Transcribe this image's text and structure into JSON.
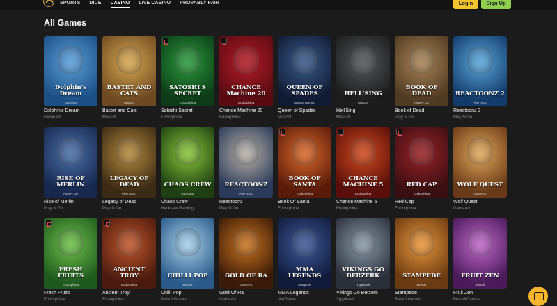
{
  "nav": {
    "items": [
      {
        "label": "SPORTS"
      },
      {
        "label": "DICE"
      },
      {
        "label": "CASINO"
      },
      {
        "label": "LIVE CASINO"
      },
      {
        "label": "PROVABLY FAIR"
      }
    ],
    "active": "CASINO",
    "login_label": "Login",
    "signup_label": "Sign Up"
  },
  "section": {
    "title": "All Games"
  },
  "games": [
    {
      "name": "Dolphin's Dream",
      "provider": "GameArt",
      "thumb_title": "Dolphin's Dream",
      "thumb_provider": "Gameart",
      "badge": false,
      "colors": [
        "#1c4f86",
        "#5b9fd8"
      ]
    },
    {
      "name": "Bastet and Cats",
      "provider": "Mascot",
      "thumb_title": "BASTET AND CATS",
      "thumb_provider": "Mascot",
      "badge": false,
      "colors": [
        "#6e4a22",
        "#d7a84f"
      ]
    },
    {
      "name": "Satoshi Secret",
      "provider": "Endorphina",
      "thumb_title": "SATOSHI'S SECRET",
      "thumb_provider": "Endorphina",
      "badge": true,
      "colors": [
        "#0d3b17",
        "#2a9a3c"
      ]
    },
    {
      "name": "Chance Machine 20",
      "provider": "Endorphina",
      "thumb_title": "CHANCE Machine 20",
      "thumb_provider": "Endorphina",
      "badge": true,
      "colors": [
        "#5a0b12",
        "#b21a26"
      ]
    },
    {
      "name": "Queen of Spades",
      "provider": "Mascot",
      "thumb_title": "QUEEN OF SPADES",
      "thumb_provider": "Mascot gaming",
      "badge": false,
      "colors": [
        "#101a33",
        "#3a5a8a"
      ]
    },
    {
      "name": "Hell'Sing",
      "provider": "Mascot",
      "thumb_title": "HELL'SING",
      "thumb_provider": "Mascot",
      "badge": false,
      "colors": [
        "#1c1c1c",
        "#55575a"
      ]
    },
    {
      "name": "Book of Dead",
      "provider": "Play N Go",
      "thumb_title": "BOOK OF DEAD",
      "thumb_provider": "Play N Go",
      "badge": false,
      "colors": [
        "#4f3a22",
        "#a88456"
      ]
    },
    {
      "name": "Reactoonz 2",
      "provider": "Play N Go",
      "thumb_title": "REACTOONZ 2",
      "thumb_provider": "Play N Go",
      "badge": false,
      "colors": [
        "#123a6a",
        "#59a7da"
      ]
    },
    {
      "name": "Rise of Merlin",
      "provider": "Play N Go",
      "thumb_title": "RISE OF MERLIN",
      "thumb_provider": "Play N Go",
      "badge": false,
      "colors": [
        "#17284e",
        "#4a6fa8"
      ]
    },
    {
      "name": "Legacy of Dead",
      "provider": "Play N Go",
      "thumb_title": "LEGACY OF DEAD",
      "thumb_provider": "Play N Go",
      "badge": false,
      "colors": [
        "#3b2a14",
        "#b58a3c"
      ]
    },
    {
      "name": "Chaos Crew",
      "provider": "Hacksaw Gaming",
      "thumb_title": "CHAOS CREW",
      "thumb_provider": "Hacksaw",
      "badge": false,
      "colors": [
        "#1d3f12",
        "#8ac63a"
      ]
    },
    {
      "name": "Reactoonz",
      "provider": "Play N Go",
      "thumb_title": "REACTOONZ",
      "thumb_provider": "Play N Go",
      "badge": false,
      "colors": [
        "#2a3a5a",
        "#b9b2a6"
      ]
    },
    {
      "name": "Book Of Santa",
      "provider": "Endorphina",
      "thumb_title": "BOOK OF SANTA",
      "thumb_provider": "Endorphina",
      "badge": true,
      "colors": [
        "#5a1a0a",
        "#d9692a"
      ]
    },
    {
      "name": "Chance Machine 5",
      "provider": "Endorphina",
      "thumb_title": "CHANCE MACHINE 5",
      "thumb_provider": "Endorphina",
      "badge": true,
      "colors": [
        "#5a0f0a",
        "#cf4a1e"
      ]
    },
    {
      "name": "Red Cap",
      "provider": "Endorphina",
      "thumb_title": "RED CAP",
      "thumb_provider": "Endorphina",
      "badge": true,
      "colors": [
        "#3b0f12",
        "#9a2227"
      ]
    },
    {
      "name": "Wolf Quest",
      "provider": "GameArt",
      "thumb_title": "WOLF QUEST",
      "thumb_provider": "GameArt",
      "badge": false,
      "colors": [
        "#6a3a18",
        "#e0a85a"
      ]
    },
    {
      "name": "Fresh Fruits",
      "provider": "Endorphina",
      "thumb_title": "FRESH FRUITS",
      "thumb_provider": "Endorphina",
      "badge": true,
      "colors": [
        "#1e5a1e",
        "#6fbf4a"
      ]
    },
    {
      "name": "Ancient Troy",
      "provider": "Endorphina",
      "thumb_title": "ANCIENT TROY",
      "thumb_provider": "Endorphina",
      "badge": true,
      "colors": [
        "#4a1a0e",
        "#c0562a"
      ]
    },
    {
      "name": "Chilli Pop",
      "provider": "BetsoftGames",
      "thumb_title": "CHILLI POP",
      "thumb_provider": "Betsoft",
      "badge": false,
      "colors": [
        "#2a5a8a",
        "#a8d0e8"
      ]
    },
    {
      "name": "Gold Of Ra",
      "provider": "GameArt",
      "thumb_title": "GOLD OF RA",
      "thumb_provider": "GameArt",
      "badge": false,
      "colors": [
        "#3a1a08",
        "#c8741e"
      ]
    },
    {
      "name": "MMA Legends",
      "provider": "NetGame",
      "thumb_title": "MMA LEGENDS",
      "thumb_provider": "Netgame",
      "badge": false,
      "colors": [
        "#101a3a",
        "#3f5a9a"
      ]
    },
    {
      "name": "Vikings Go Berzerk",
      "provider": "Yggdrasil",
      "thumb_title": "VIKINGS GO BERZERK",
      "thumb_provider": "Yggdrasil",
      "badge": false,
      "colors": [
        "#2a2f3a",
        "#8a9aa8"
      ]
    },
    {
      "name": "Stampede",
      "provider": "BetsoftGames",
      "thumb_title": "STAMPEDE",
      "thumb_provider": "Betsoft",
      "badge": false,
      "colors": [
        "#6a3a12",
        "#e8963a"
      ]
    },
    {
      "name": "Fruit Zen",
      "provider": "BetsoftGames",
      "thumb_title": "FRUIT ZEN",
      "thumb_provider": "Betsoft",
      "badge": false,
      "colors": [
        "#4a1a5a",
        "#c068c8"
      ]
    }
  ],
  "theme": {
    "background": "#1b1b1c",
    "login": "#f2c52c",
    "signup": "#8fd14f",
    "chat": "#f5b62e"
  },
  "icons": {
    "logo": "casino-logo-icon",
    "chat": "chat-icon",
    "provider_badge": "endorphina-badge-icon"
  }
}
